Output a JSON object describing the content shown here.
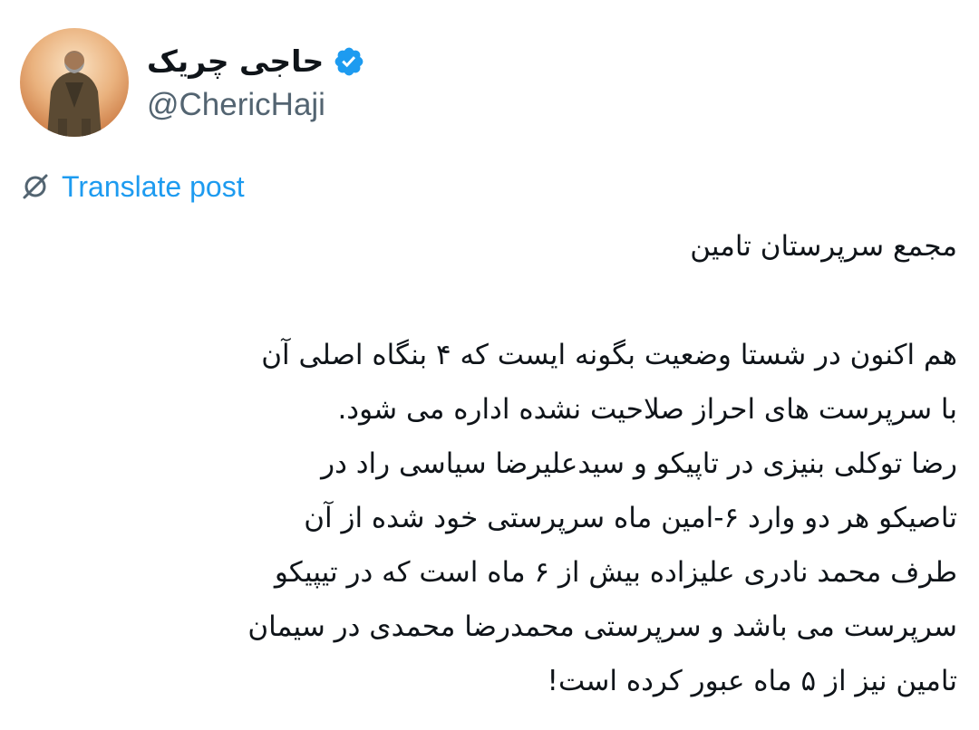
{
  "author": {
    "display_name": "حاجی چریک",
    "handle": "@ChericHaji",
    "verified": true,
    "verified_color": "#1d9bf0",
    "avatar_icon": "profile-photo"
  },
  "translate": {
    "icon": "translate-icon",
    "label": "Translate post",
    "color": "#1d9bf0"
  },
  "post": {
    "title": "مجمع سرپرستان تامین",
    "lines": [
      "هم اکنون در شستا وضعیت بگونه ایست که ۴ بنگاه اصلی آن",
      "با سرپرست های احراز صلاحیت نشده اداره می شود.",
      "رضا توکلی بنیزی در تاپیکو و سیدعلیرضا سیاسی راد در",
      "تاصیکو هر دو وارد ۶-امین ماه سرپرستی خود شده از آن",
      "طرف محمد نادری علیزاده بیش از ۶ ماه است که در تیپیکو",
      "سرپرست می باشد و سرپرستی محمدرضا محمدی در سیمان",
      "تامین نیز از ۵ ماه عبور کرده است!"
    ]
  }
}
